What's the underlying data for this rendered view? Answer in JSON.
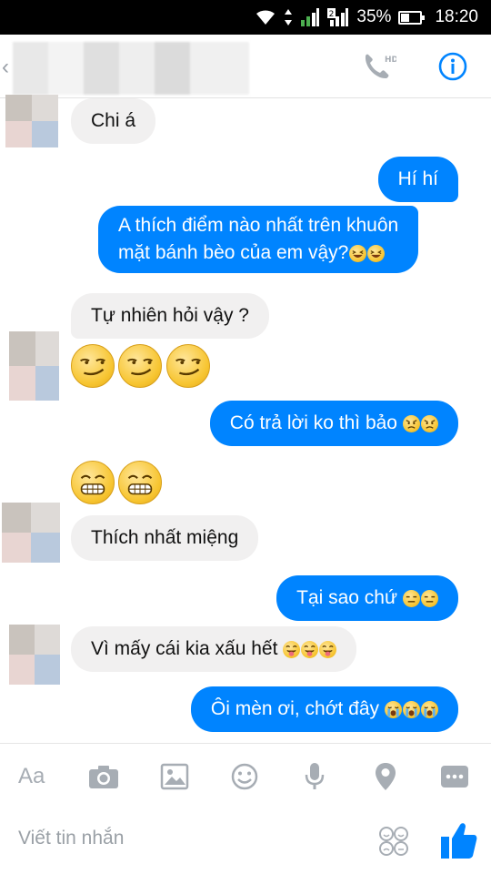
{
  "status_bar": {
    "battery": "35%",
    "time": "18:20",
    "signal_slot": "2"
  },
  "header": {
    "call_badge": "HD"
  },
  "messages": [
    {
      "dir": "in",
      "text": "Chi á"
    },
    {
      "dir": "out",
      "text": "Hí hí"
    },
    {
      "dir": "out",
      "line1": "A thích điểm nào nhất trên khuôn",
      "line2": "mặt bánh bèo của em vậy?"
    },
    {
      "dir": "in",
      "text": "Tự nhiên hỏi vậy ?"
    },
    {
      "dir": "in",
      "emoji": "smirk"
    },
    {
      "dir": "out",
      "text": "Có trả lời ko thì bảo"
    },
    {
      "dir": "in",
      "emoji": "grimace"
    },
    {
      "dir": "in",
      "text": "Thích nhất miệng"
    },
    {
      "dir": "out",
      "text": "Tại sao chứ"
    },
    {
      "dir": "in",
      "text": "Vì mấy cái kia xấu hết"
    },
    {
      "dir": "out",
      "text": "Ôi mèn ơi, chớt đây"
    }
  ],
  "composer": {
    "aa_label": "Aa",
    "placeholder": "Viết tin nhắn",
    "tools": [
      "camera-icon",
      "image-icon",
      "emoji-icon",
      "microphone-icon",
      "location-icon",
      "more-icon"
    ]
  },
  "colors": {
    "accent": "#0084ff",
    "incoming": "#f1f0f0"
  }
}
